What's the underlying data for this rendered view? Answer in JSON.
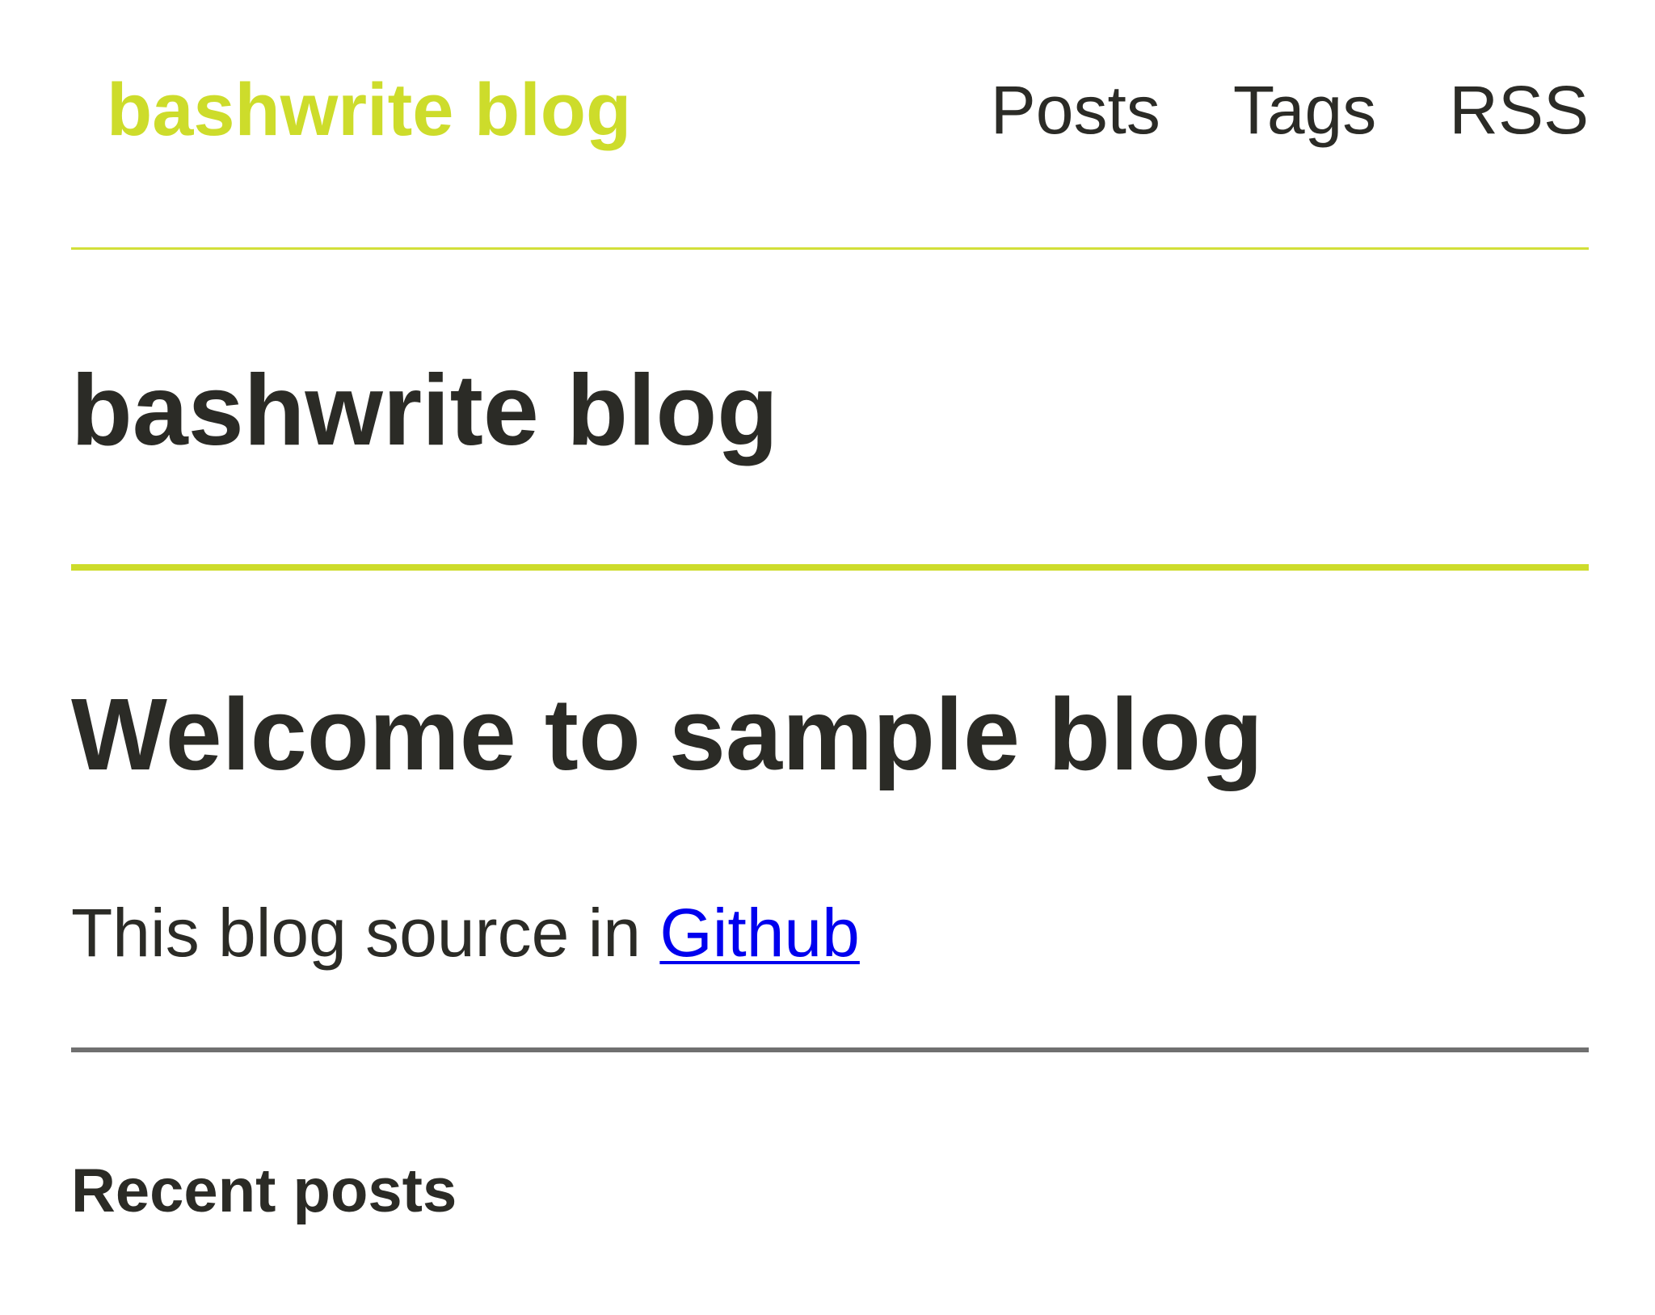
{
  "header": {
    "brand": "bashwrite blog",
    "nav": [
      "Posts",
      "Tags",
      "RSS"
    ]
  },
  "main": {
    "site_title": "bashwrite blog",
    "welcome_heading": "Welcome to sample blog",
    "source_text": "This blog source in ",
    "source_link": "Github",
    "recent_heading": "Recent posts"
  },
  "colors": {
    "accent": "#cddc2b",
    "text": "#2b2b26",
    "link": "#0000ee",
    "divider": "#707070"
  }
}
